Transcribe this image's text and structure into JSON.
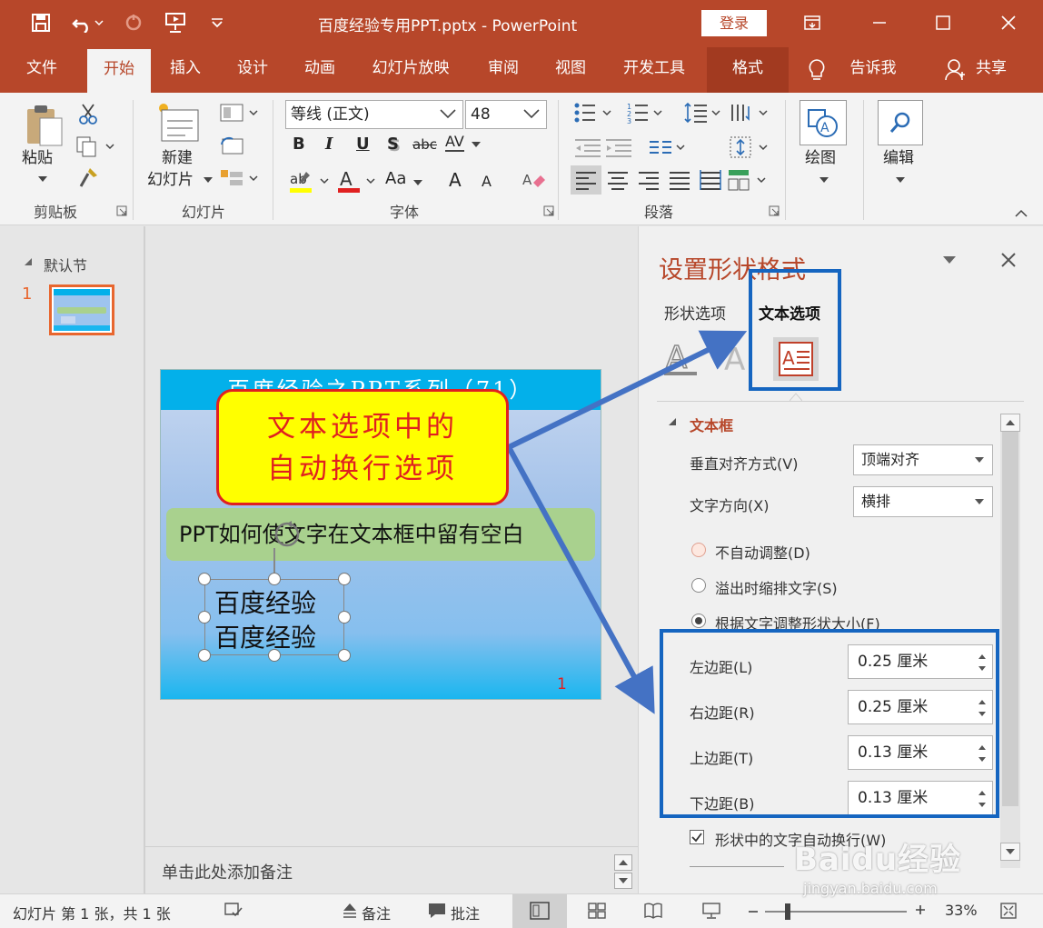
{
  "titlebar": {
    "title": "百度经验专用PPT.pptx  -  PowerPoint",
    "login": "登录"
  },
  "tabs": [
    "文件",
    "开始",
    "插入",
    "设计",
    "动画",
    "幻灯片放映",
    "审阅",
    "视图",
    "开发工具",
    "格式",
    "告诉我",
    "共享"
  ],
  "ribbon": {
    "paste": "粘贴",
    "clipboard": "剪贴板",
    "new_slide_1": "新建",
    "new_slide_2": "幻灯片",
    "slides_group": "幻灯片",
    "font_name": "等线 (正文)",
    "font_size": "48",
    "font_group": "字体",
    "para_group": "段落",
    "drawing": "绘图",
    "editing": "编辑",
    "fmt_b": "B",
    "fmt_i": "I",
    "fmt_u": "U",
    "fmt_s": "S",
    "fmt_abc": "abc",
    "fmt_av": "AV",
    "fmt_a": "A",
    "fmt_aa": "Aa",
    "fmt_a_up": "A",
    "fmt_a_down": "A"
  },
  "thumbs": {
    "section": "默认节",
    "slide_number": "1"
  },
  "slide": {
    "header": "百度经验之PPT系列（71）",
    "green_text": "PPT如何使文字在文本框中留有空白",
    "line1": "百度经验",
    "line2": "百度经验",
    "page_number": "1"
  },
  "notes": {
    "placeholder": "单击此处添加备注"
  },
  "callout": {
    "line1": "文本选项中的",
    "line2": "自动换行选项"
  },
  "format_pane": {
    "title": "设置形状格式",
    "tab_shape": "形状选项",
    "tab_text": "文本选项",
    "section": "文本框",
    "valign_label": "垂直对齐方式(V)",
    "valign_value": "顶端对齐",
    "direction_label": "文字方向(X)",
    "direction_value": "横排",
    "radio1": "不自动调整(D)",
    "radio2": "溢出时缩排文字(S)",
    "radio3": "根据文字调整形状大小(F)",
    "margin_left_label": "左边距(L)",
    "margin_left": "0.25 厘米",
    "margin_right_label": "右边距(R)",
    "margin_right": "0.25 厘米",
    "margin_top_label": "上边距(T)",
    "margin_top": "0.13 厘米",
    "margin_bottom_label": "下边距(B)",
    "margin_bottom": "0.13 厘米",
    "wrap_label": "形状中的文字自动换行(W)"
  },
  "statusbar": {
    "slide_info": "幻灯片 第 1 张，共 1 张",
    "notes": "备注",
    "comments": "批注",
    "zoom": "33%"
  },
  "watermark": {
    "logo": "Baidu经验",
    "url": "jingyan.baidu.com"
  },
  "colors": {
    "brand": "#b7472a",
    "annotation_blue": "#1565c0",
    "callout_fill": "#ffff00",
    "callout_text": "#e02020"
  }
}
